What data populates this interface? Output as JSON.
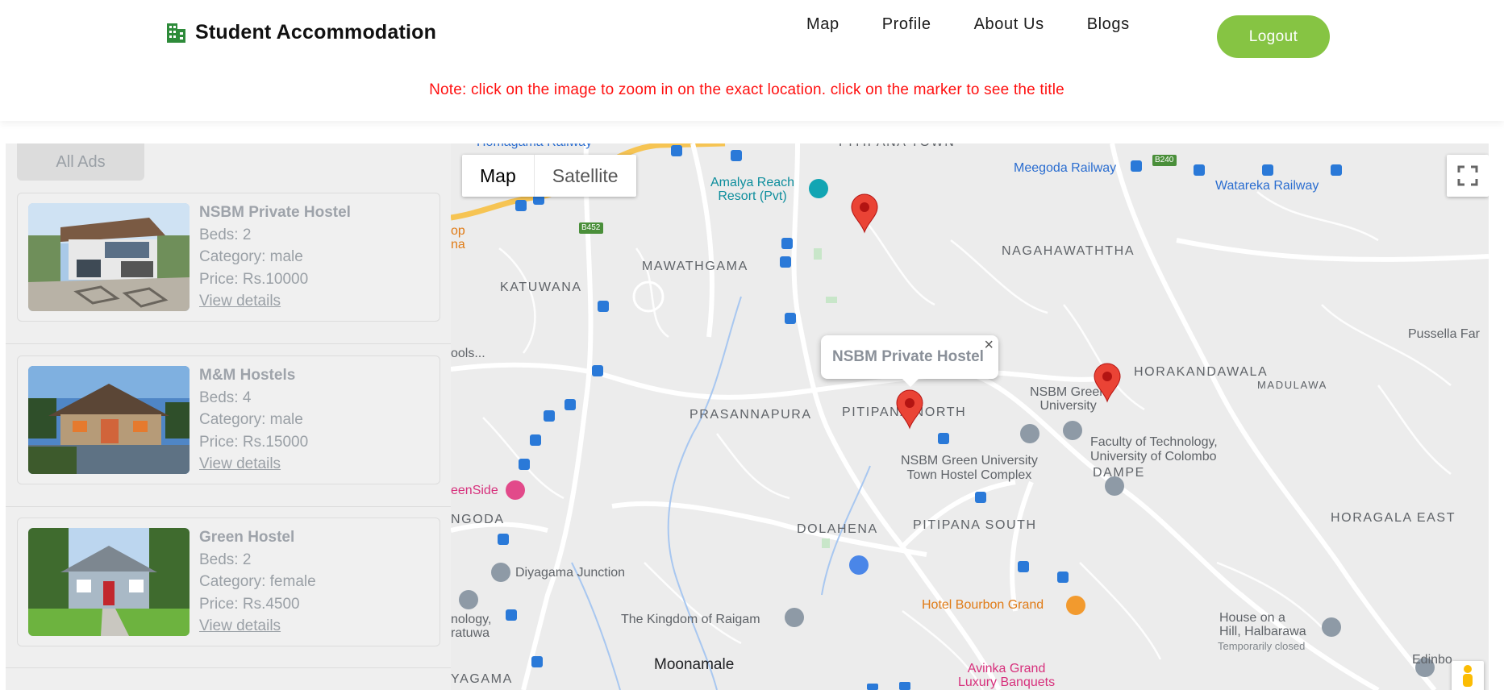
{
  "header": {
    "brand": "Student Accommodation",
    "nav": [
      "Map",
      "Profile",
      "About Us",
      "Blogs"
    ],
    "logout": "Logout",
    "note": "Note: click on the image to zoom in on the exact location. click on the marker to see the title"
  },
  "sidebar": {
    "all_ads": "All Ads",
    "listings": [
      {
        "title": "NSBM Private Hostel",
        "beds": "Beds: 2",
        "category": "Category: male",
        "price": "Price: Rs.10000",
        "link": "View details"
      },
      {
        "title": "M&M Hostels",
        "beds": "Beds: 4",
        "category": "Category: male",
        "price": "Price: Rs.15000",
        "link": "View details"
      },
      {
        "title": "Green Hostel",
        "beds": "Beds: 2",
        "category": "Category: female",
        "price": "Price: Rs.4500",
        "link": "View details"
      }
    ]
  },
  "map": {
    "map_type": {
      "map": "Map",
      "satellite": "Satellite"
    },
    "infowindow": {
      "title": "NSBM Private Hostel",
      "close": "×"
    },
    "areas": [
      "PITIPANA TOWN",
      "MAWATHGAMA",
      "KATUWANA",
      "NAGAHAWATHTHA",
      "HORAKANDAWALA",
      "MADULAWA",
      "PRASANNAPURA",
      "PITIPANA NORTH",
      "DAMPE",
      "HORAGALA EAST",
      "DOLAHENA",
      "PITIPANA SOUTH",
      "NGODA",
      "YAGAMA"
    ],
    "pois": {
      "amalya": "Amalya Reach\nResort (Pvt)",
      "meegoda": "Meegoda Railway",
      "watareka": "Watareka Railway",
      "nsbm": "NSBM Green\nUniversity",
      "pussella": "Pussella Far",
      "faculty": "Faculty of Technology,\nUniversity of Colombo",
      "complex": "NSBM Green University\nTown Hostel Complex",
      "greenside": "eenSide",
      "diyagama": "Diyagama Junction",
      "raigam": "The Kingdom of Raigam",
      "bourbon": "Hotel Bourbon Grand",
      "house": "House on a\nHill, Halbarawa",
      "closed": "Temporarily closed",
      "moonamale": "Moonamale",
      "avinka": "Avinka Grand\nLuxury Banquets",
      "ology": "nology,\nratuwa",
      "homagama": "Homagama Railway",
      "edinbo": "Edinbo",
      "op": "op\nna",
      "ools": "ools...",
      "road": "B240",
      "road2": "B452"
    }
  }
}
